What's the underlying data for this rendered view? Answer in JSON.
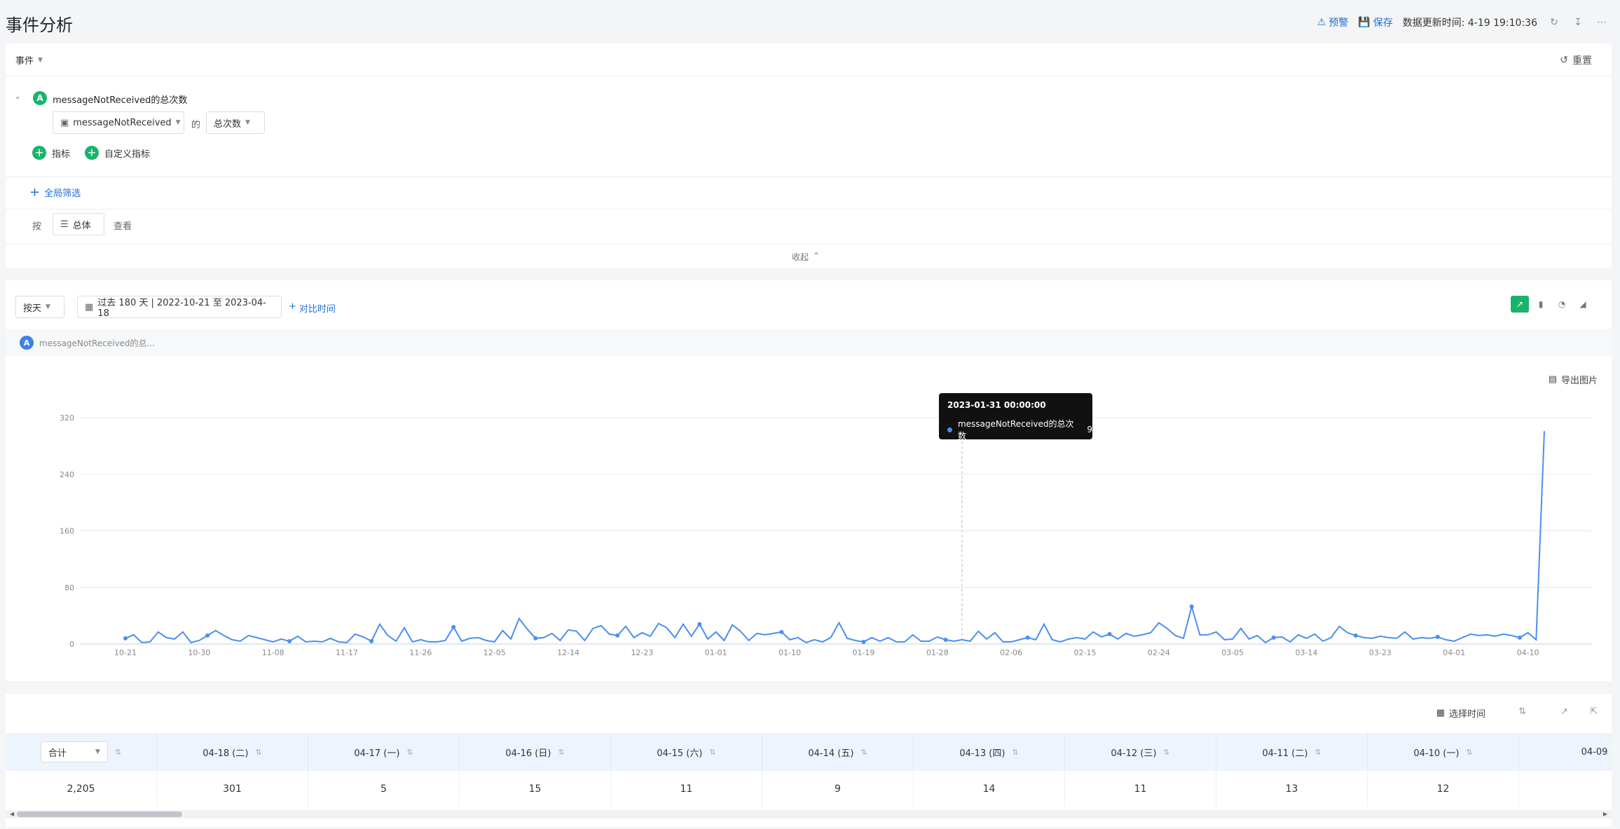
{
  "header": {
    "title": "事件分析",
    "alert_label": "预警",
    "save_label": "保存",
    "update_time": "数据更新时间: 4-19 19:10:36"
  },
  "query": {
    "event_toggle": "事件",
    "reset_label": "重置",
    "metric_letter": "A",
    "metric_title": "messageNotReceived的总次数",
    "event_select": "messageNotReceived",
    "of_label": "的",
    "agg_select": "总次数",
    "add_metric": "指标",
    "add_custom_metric": "自定义指标",
    "global_filter": "全局筛选",
    "group_prefix": "按",
    "group_value": "总体",
    "group_suffix": "查看",
    "collapse_label": "收起"
  },
  "chart_toolbar": {
    "granularity": "按天",
    "date_range": "过去 180 天 | 2022-10-21 至 2023-04-18",
    "compare_label": "对比时间",
    "legend_letter": "A",
    "legend_text": "messageNotReceived的总...",
    "export_label": "导出图片"
  },
  "tooltip": {
    "title": "2023-01-31 00:00:00",
    "series": "messageNotReceived的总次数",
    "value": "9"
  },
  "chart_data": {
    "type": "line",
    "y_ticks": [
      "0",
      "80",
      "160",
      "240",
      "320"
    ],
    "ylim": [
      0,
      320
    ],
    "x_tick_labels": [
      "10-21",
      "10-30",
      "11-08",
      "11-17",
      "11-26",
      "12-05",
      "12-14",
      "12-23",
      "01-01",
      "01-10",
      "01-19",
      "01-28",
      "02-06",
      "02-15",
      "02-24",
      "03-05",
      "03-14",
      "03-23",
      "04-01",
      "04-10"
    ],
    "series": [
      {
        "color": "#4a8ff0",
        "values": [
          8,
          13,
          2,
          3,
          17,
          9,
          7,
          17,
          2,
          5,
          12,
          19,
          12,
          6,
          4,
          12,
          9,
          6,
          3,
          7,
          4,
          11,
          3,
          4,
          3,
          8,
          3,
          2,
          14,
          10,
          4,
          28,
          12,
          4,
          23,
          3,
          6,
          3,
          3,
          5,
          24,
          4,
          8,
          9,
          5,
          3,
          19,
          7,
          36,
          21,
          8,
          9,
          15,
          5,
          20,
          18,
          5,
          22,
          26,
          14,
          12,
          25,
          9,
          16,
          11,
          29,
          23,
          9,
          28,
          11,
          28,
          7,
          17,
          5,
          27,
          18,
          5,
          15,
          13,
          15,
          17,
          6,
          9,
          2,
          6,
          3,
          9,
          30,
          8,
          5,
          3,
          9,
          4,
          9,
          3,
          3,
          13,
          4,
          4,
          10,
          6,
          4,
          6,
          4,
          18,
          7,
          16,
          3,
          3,
          6,
          9,
          6,
          28,
          6,
          3,
          7,
          9,
          7,
          17,
          10,
          14,
          7,
          15,
          11,
          13,
          16,
          30,
          22,
          12,
          8,
          53,
          13,
          13,
          17,
          6,
          7,
          22,
          7,
          12,
          2,
          9,
          10,
          3,
          13,
          8,
          14,
          4,
          9,
          25,
          16,
          12,
          9,
          8,
          11,
          9,
          8,
          17,
          7,
          9,
          8,
          10,
          6,
          4,
          9,
          14,
          12,
          13,
          11,
          14,
          12,
          9,
          16,
          6,
          301
        ]
      }
    ]
  },
  "table": {
    "toolbar_select_time": "选择时间",
    "total_select": "合计",
    "columns": [
      "04-18 (二)",
      "04-17 (一)",
      "04-16 (日)",
      "04-15 (六)",
      "04-14 (五)",
      "04-13 (四)",
      "04-12 (三)",
      "04-11 (二)",
      "04-10 (一)",
      "04-09"
    ],
    "total_value": "2,205",
    "values": [
      "301",
      "5",
      "15",
      "11",
      "9",
      "14",
      "11",
      "13",
      "12"
    ]
  }
}
